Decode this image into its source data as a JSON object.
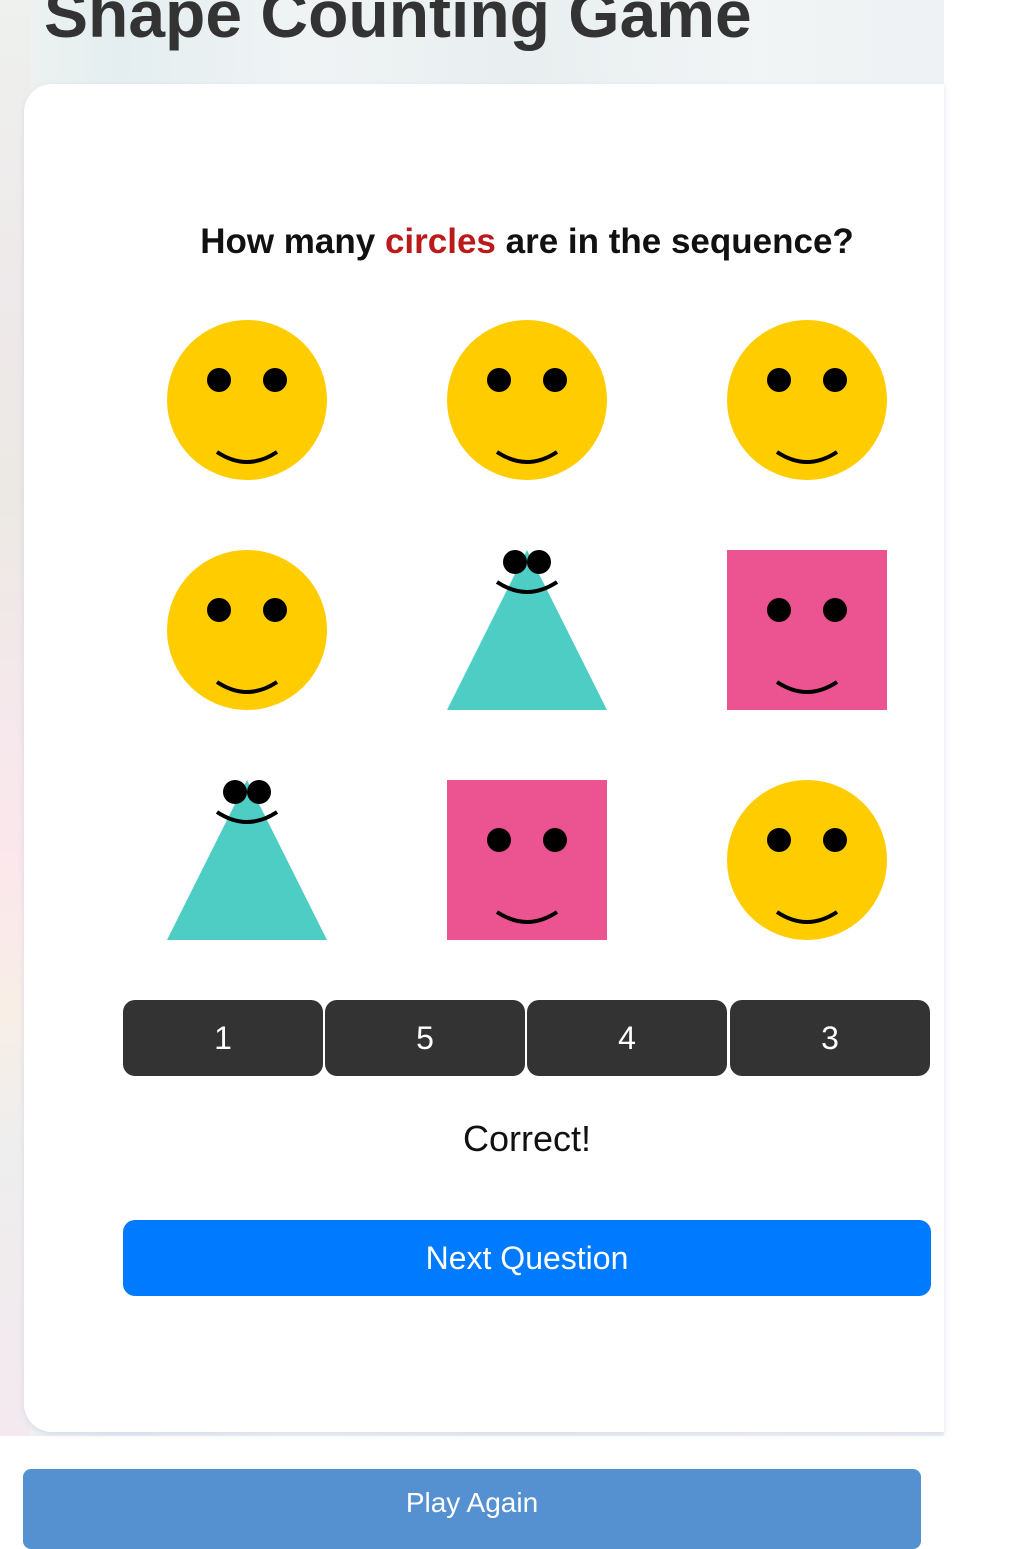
{
  "page": {
    "title": "Shape Counting Game"
  },
  "question": {
    "prefix": "How many ",
    "target": "circles",
    "suffix": " are in the sequence?"
  },
  "colors": {
    "circle": "#ffcc00",
    "triangle": "#4ecdc4",
    "square": "#eb5491",
    "target_word": "#bb1a1a",
    "answer_button": "#333333",
    "next_button": "#007bff",
    "play_again_button": "#5590d0"
  },
  "shapes": [
    {
      "shape": "circle",
      "face": "smiley"
    },
    {
      "shape": "circle",
      "face": "smiley"
    },
    {
      "shape": "circle",
      "face": "smiley"
    },
    {
      "shape": "circle",
      "face": "smiley"
    },
    {
      "shape": "triangle",
      "face": "smiley"
    },
    {
      "shape": "square",
      "face": "smiley"
    },
    {
      "shape": "triangle",
      "face": "smiley"
    },
    {
      "shape": "square",
      "face": "smiley"
    },
    {
      "shape": "circle",
      "face": "smiley"
    }
  ],
  "answers": [
    "1",
    "5",
    "4",
    "3"
  ],
  "feedback": "Correct!",
  "next_button_label": "Next Question",
  "play_again_label": "Play Again"
}
